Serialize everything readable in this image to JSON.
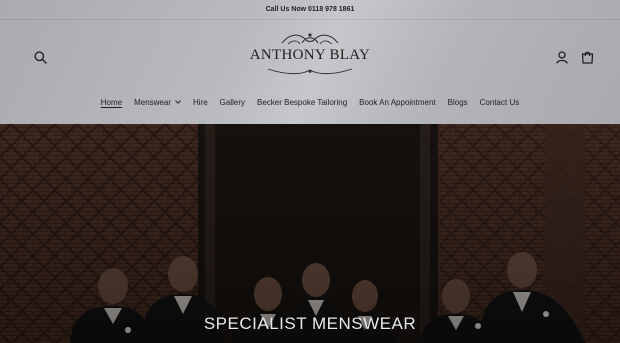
{
  "announcement": {
    "text": "Call Us Now 0118 978 1861"
  },
  "header": {
    "logo_text": "ANTHONY BLAY",
    "search_icon": "search-icon",
    "account_icon": "account-icon",
    "cart_icon": "cart-icon"
  },
  "nav": {
    "items": [
      {
        "label": "Home",
        "active": true
      },
      {
        "label": "Menswear",
        "has_dropdown": true
      },
      {
        "label": "Hire"
      },
      {
        "label": "Gallery"
      },
      {
        "label": "Becker Bespoke Tailoring"
      },
      {
        "label": "Book An Appointment"
      },
      {
        "label": "Blogs"
      },
      {
        "label": "Contact Us"
      }
    ]
  },
  "hero": {
    "heading": "SPECIALIST MENSWEAR"
  },
  "colors": {
    "header_bg": "#b4b6b9",
    "text": "#1a1a1a",
    "hero_overlay": "#2b1e18",
    "hero_text": "#e9e9e9"
  }
}
